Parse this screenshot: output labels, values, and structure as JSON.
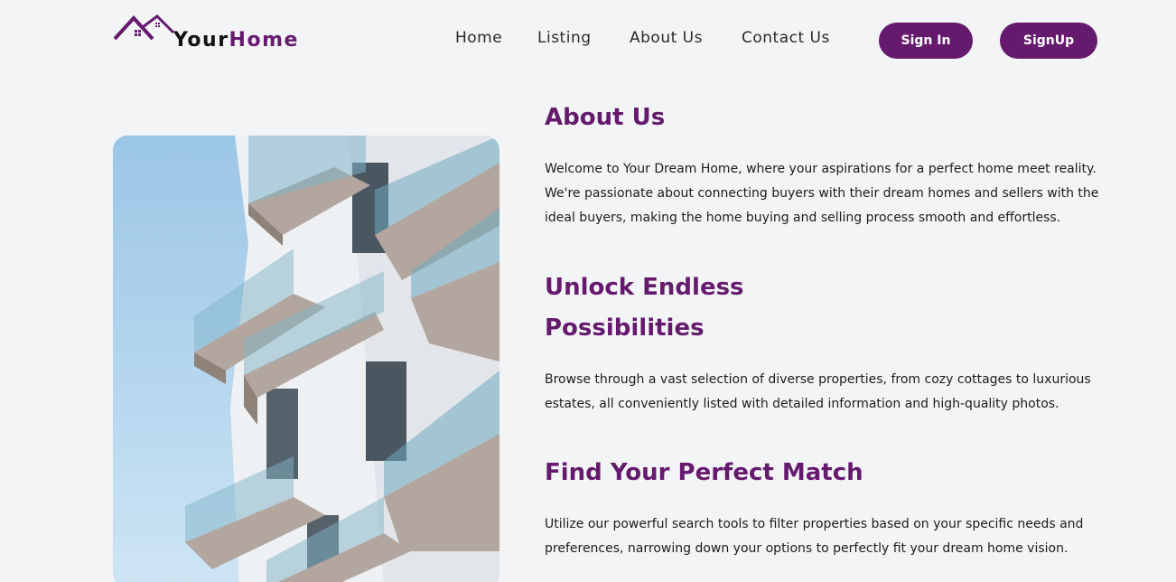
{
  "brand": {
    "part1": "Your",
    "part2": "Home"
  },
  "nav": {
    "home": "Home",
    "listing": "Listing",
    "about": "About Us",
    "contact": "Contact Us"
  },
  "auth": {
    "signin": "Sign In",
    "signup": "SignUp"
  },
  "colors": {
    "accent": "#651a6e",
    "background": "#f3f4f6"
  },
  "about": {
    "title": "About Us",
    "body": "Welcome to Your Dream Home, where your aspirations for a perfect home meet reality. We're passionate about connecting buyers with their dream homes and sellers with the ideal buyers, making the home buying and selling process smooth and effortless."
  },
  "unlock": {
    "title_line1": "Unlock Endless",
    "title_line2": "Possibilities",
    "body": "Browse through a vast selection of diverse properties, from cozy cottages to luxurious estates, all conveniently listed with detailed information and high-quality photos."
  },
  "match": {
    "title": "Find Your Perfect Match",
    "body": "Utilize our powerful search tools to filter properties based on your specific needs and preferences, narrowing down your options to perfectly fit your dream home vision."
  }
}
